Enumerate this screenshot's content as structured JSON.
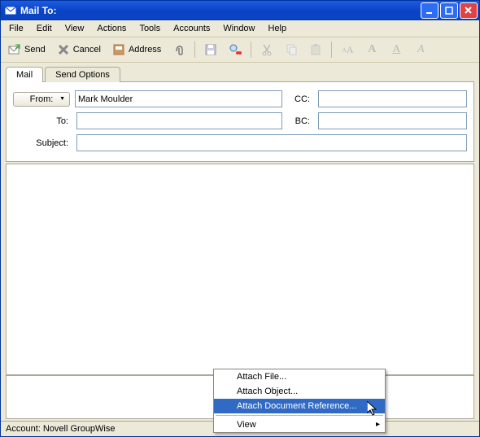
{
  "window": {
    "title": "Mail To:"
  },
  "menu": {
    "file": "File",
    "edit": "Edit",
    "view": "View",
    "actions": "Actions",
    "tools": "Tools",
    "accounts": "Accounts",
    "window": "Window",
    "help": "Help"
  },
  "toolbar": {
    "send": "Send",
    "cancel": "Cancel",
    "address": "Address"
  },
  "tabs": {
    "mail": "Mail",
    "options": "Send Options"
  },
  "fields": {
    "from_label": "From:",
    "from_value": "Mark Moulder",
    "to_label": "To:",
    "to_value": "",
    "cc_label": "CC:",
    "cc_value": "",
    "bc_label": "BC:",
    "bc_value": "",
    "subject_label": "Subject:",
    "subject_value": ""
  },
  "status": {
    "account": "Account: Novell GroupWise"
  },
  "context": {
    "attach_file": "Attach File...",
    "attach_object": "Attach Object...",
    "attach_docref": "Attach Document Reference...",
    "view": "View"
  }
}
